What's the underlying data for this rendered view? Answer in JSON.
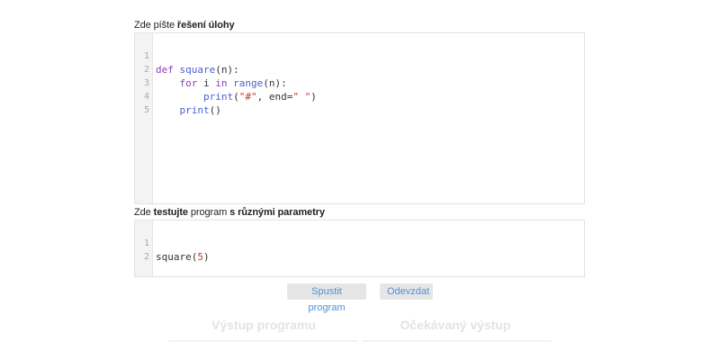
{
  "solution": {
    "label_prefix": "Zde píšte ",
    "label_bold": "řešení úlohy",
    "code_lines": [
      {
        "num": "1"
      },
      {
        "num": "2"
      },
      {
        "num": "3"
      },
      {
        "num": "4"
      },
      {
        "num": "5"
      }
    ],
    "tokens": {
      "l1_def": "def",
      "l1_fn": "square",
      "l1_rest": "(n):",
      "l2_for": "for",
      "l2_i": " i ",
      "l2_in": "in",
      "l2_range": "range",
      "l2_rest": "(n):",
      "l3_print": "print",
      "l3_open": "(",
      "l3_str": "\"#\"",
      "l3_mid": ", end=",
      "l3_str2": "\" \"",
      "l3_close": ")",
      "l4_print": "print",
      "l4_rest": "()"
    }
  },
  "test": {
    "label_prefix": "Zde ",
    "label_bold1": "testujte",
    "label_mid": " program ",
    "label_bold2": "s různými parametry",
    "code_lines": [
      {
        "num": "1"
      },
      {
        "num": "2"
      }
    ],
    "tokens": {
      "l1_fn": "square",
      "l1_open": "(",
      "l1_num": "5",
      "l1_close": ")"
    }
  },
  "buttons": {
    "run": "Spustit program",
    "submit": "Odevzdat"
  },
  "output": {
    "program_output_title": "Výstup programu",
    "expected_output_title": "Očekávaný výstup"
  },
  "colors": {
    "keyword": "#8a3fb2",
    "function": "#4a5fd0",
    "string": "#c0392b",
    "button_text": "#4e8fd6",
    "button_bg": "#e6e6e6"
  }
}
